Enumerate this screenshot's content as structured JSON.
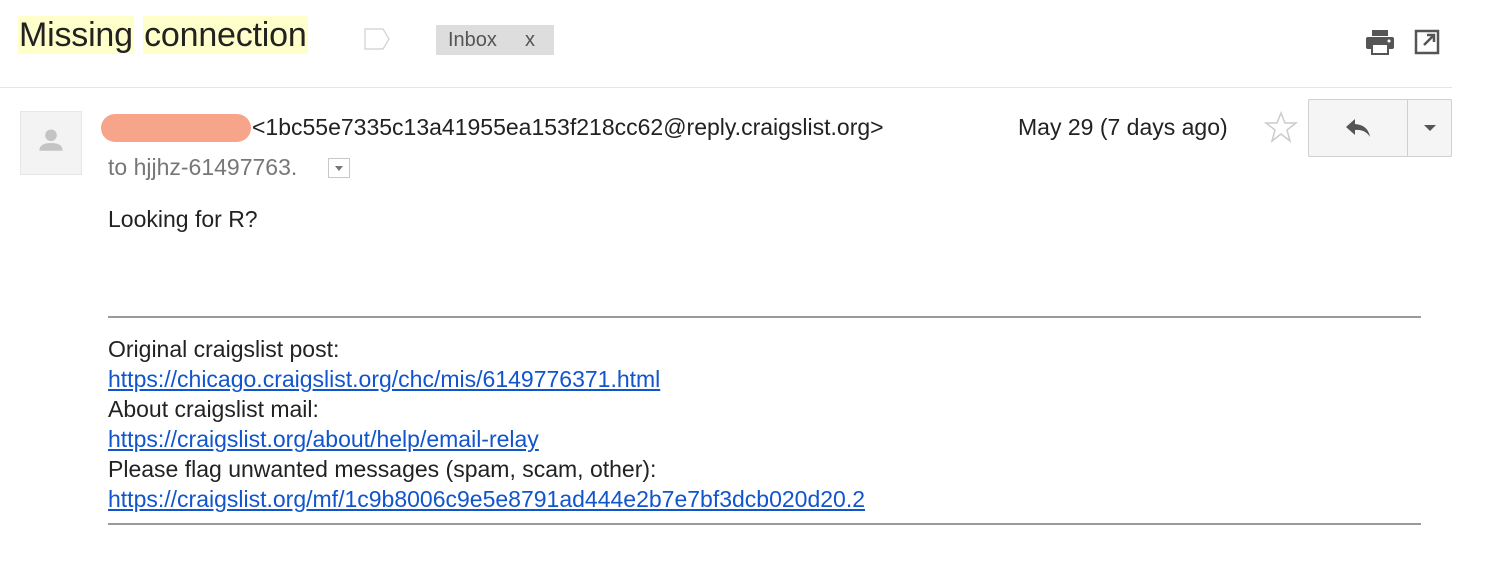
{
  "thread": {
    "subject_part1": "Missing",
    "subject_part2": "connection",
    "label_chip": "Inbox",
    "label_chip_remove": "x"
  },
  "message": {
    "sender_email": "<1bc55e7335c13a41955ea153f218cc62@reply.craigslist.org>",
    "to_line": "to hjjhz-61497763.",
    "date": "May 29 (7 days ago)",
    "body": "Looking for R?",
    "footer": {
      "line1": "Original craigslist post:",
      "link1": "https://chicago.craigslist.org/chc/mis/6149776371.html",
      "line2": "About craigslist mail:",
      "link2": "https://craigslist.org/about/help/email-relay",
      "line3": "Please flag unwanted messages (spam, scam, other):",
      "link3": "https://craigslist.org/mf/1c9b8006c9e5e8791ad444e2b7e7bf3dcb020d20.2"
    }
  },
  "icons": {
    "label": "label-tag-icon",
    "print": "print-icon",
    "popout": "open-in-new-window-icon",
    "avatar": "default-avatar-icon",
    "star": "star-outline-icon",
    "reply": "reply-arrow-icon",
    "more": "chevron-down-icon"
  },
  "colors": {
    "subject_highlight": "#ffffcc",
    "link": "#1155cc",
    "redaction": "#f7a58a",
    "chip_bg": "#dddddd"
  }
}
